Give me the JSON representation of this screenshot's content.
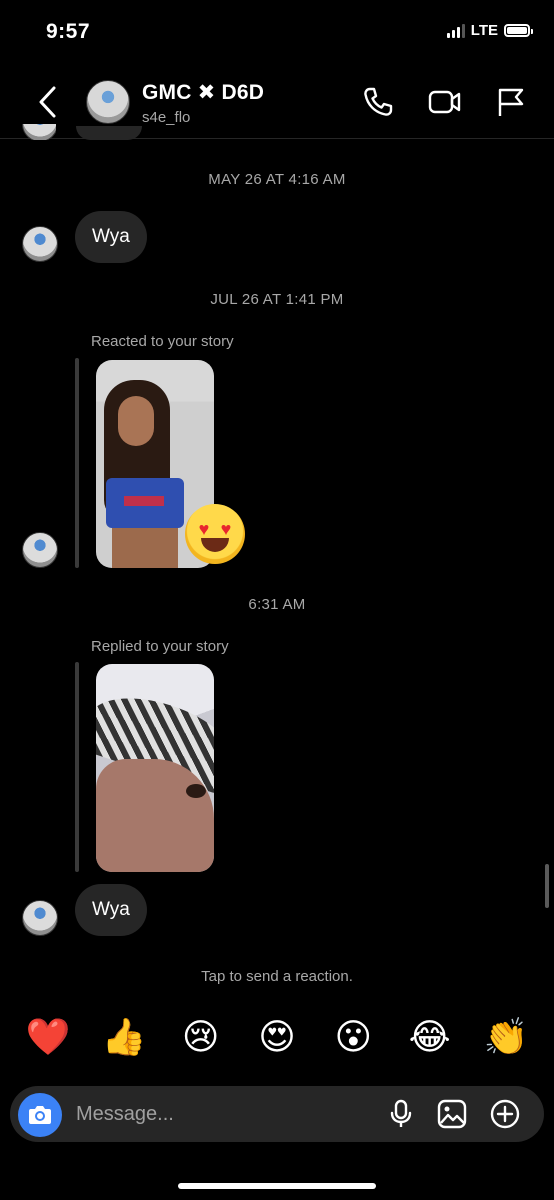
{
  "status_bar": {
    "time": "9:57",
    "network": "LTE"
  },
  "header": {
    "title": "GMC ✖ D6D",
    "username": "s4e_flo",
    "icons": [
      "back-chevron-icon",
      "phone-icon",
      "video-camera-icon",
      "flag-icon"
    ]
  },
  "chat": {
    "timestamp_1": "MAY 26 AT 4:16 AM",
    "message_1": "Wya",
    "timestamp_2": "JUL 26 AT 1:41 PM",
    "story_label_1": "Reacted to your story",
    "story_reaction_emoji": "😍",
    "timestamp_3": "6:31 AM",
    "story_label_2": "Replied to your story",
    "message_2": "Wya",
    "tap_hint": "Tap to send a reaction."
  },
  "reactions": [
    "❤️",
    "👍",
    "😢",
    "😍",
    "😮",
    "😂",
    "👏"
  ],
  "composer": {
    "placeholder": "Message...",
    "icons": [
      "camera-icon",
      "microphone-icon",
      "gallery-icon",
      "add-icon"
    ]
  },
  "colors": {
    "background": "#000000",
    "bubble": "#262626",
    "secondary_text": "#a8a8a8",
    "camera_button": "#3b82f6"
  }
}
